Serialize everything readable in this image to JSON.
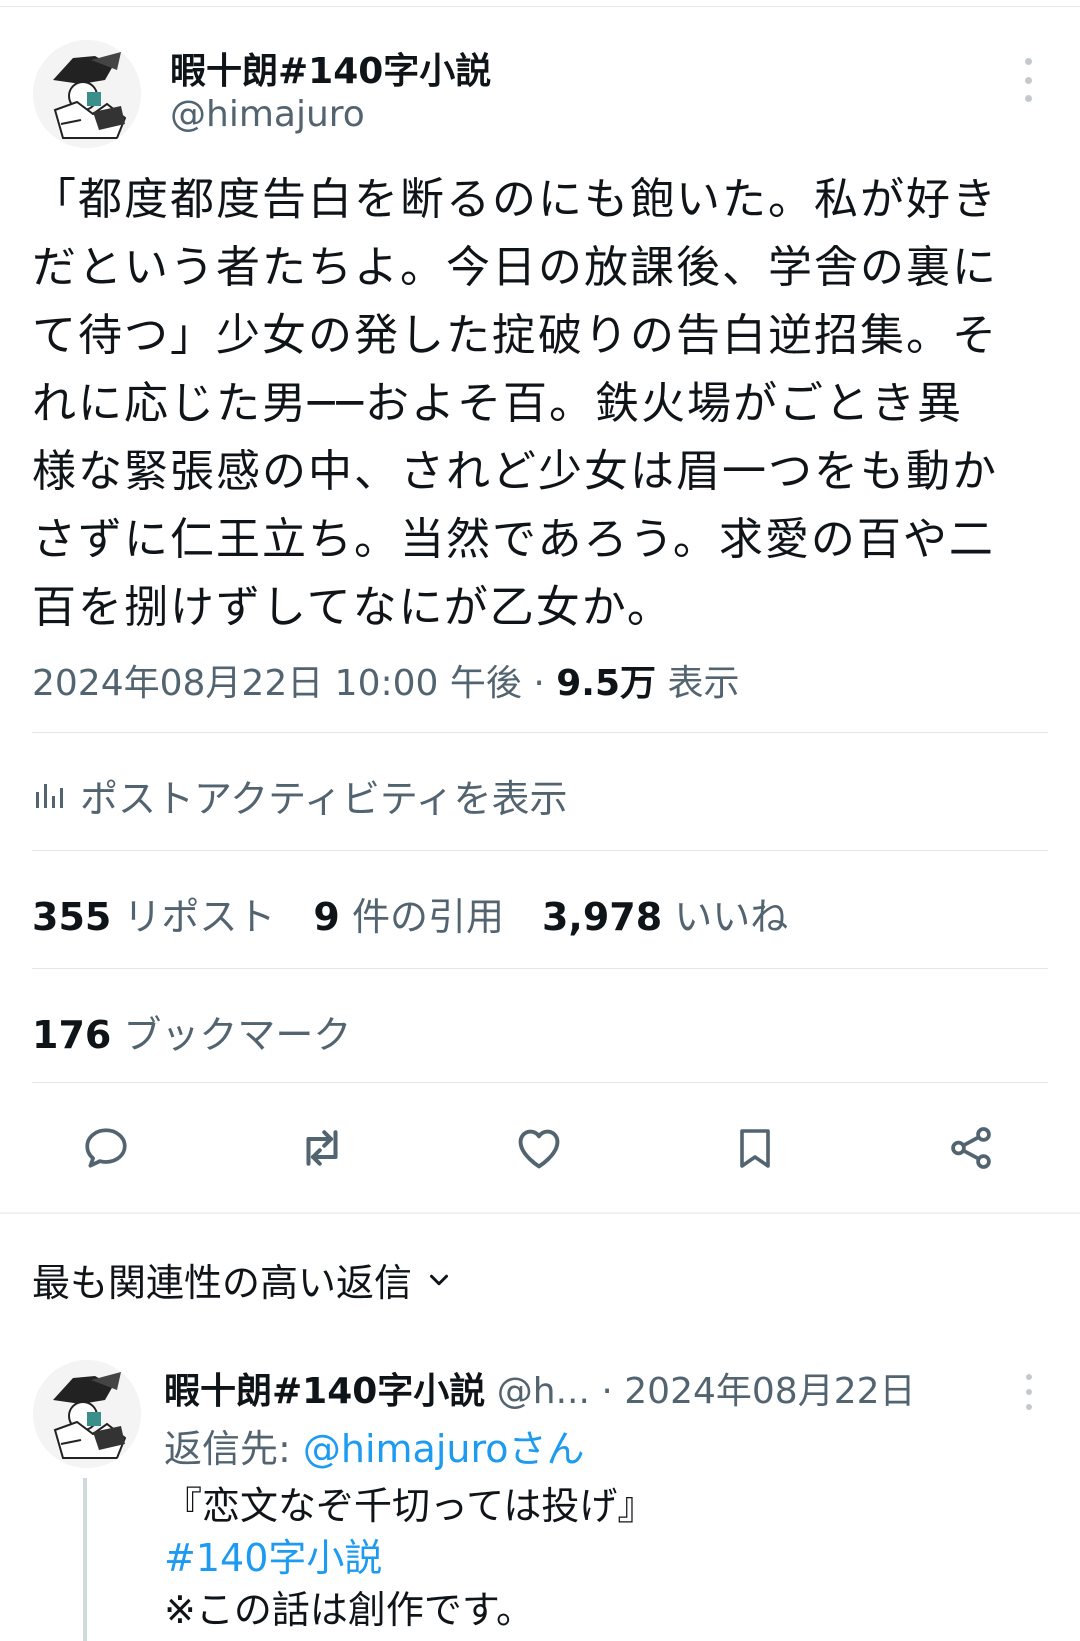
{
  "tweet": {
    "display_name": "暇十朗#140字小説",
    "handle": "@himajuro",
    "text": "「都度都度告白を断るのにも飽いた。私が好き\nだという者たちよ。今日の放課後、学舎の裏に\nて待つ」少女の発した掟破りの告白逆招集。そ\nれに応じた男──およそ百。鉄火場がごとき異\n様な緊張感の中、されど少女は眉一つをも動か\nさずに仁王立ち。当然であろう。求愛の百や二\n百を捌けずしてなにが乙女か。",
    "timestamp": "2024年08月22日 10:00 午後",
    "separator": " · ",
    "views_count": "9.5万",
    "views_label": " 表示"
  },
  "activity": {
    "label": "ポストアクティビティを表示",
    "icon": "analytics-icon"
  },
  "stats": {
    "reposts_count": "355",
    "reposts_label": " リポスト",
    "quotes_count": "9",
    "quotes_label": " 件の引用",
    "likes_count": "3,978",
    "likes_label": " いいね",
    "bookmarks_count": "176",
    "bookmarks_label": " ブックマーク"
  },
  "actions": [
    "reply-icon",
    "repost-icon",
    "like-icon",
    "bookmark-icon",
    "share-icon"
  ],
  "replies": {
    "sort_label": "最も関連性の高い返信",
    "reply": {
      "display_name": "暇十朗#140字小説",
      "handle": "@h...",
      "date": "· 2024年08月22日",
      "reply_to_label": "返信先: ",
      "reply_to_handle": "@himajuroさん",
      "line1": "『恋文なぞ千切っては投げ』",
      "hashtag": "#140字小説",
      "line3": "※この話は創作です。"
    }
  },
  "colors": {
    "text": "#0f1419",
    "secondary": "#536471",
    "link": "#1d9bf0",
    "divider": "#e4e7e9"
  }
}
